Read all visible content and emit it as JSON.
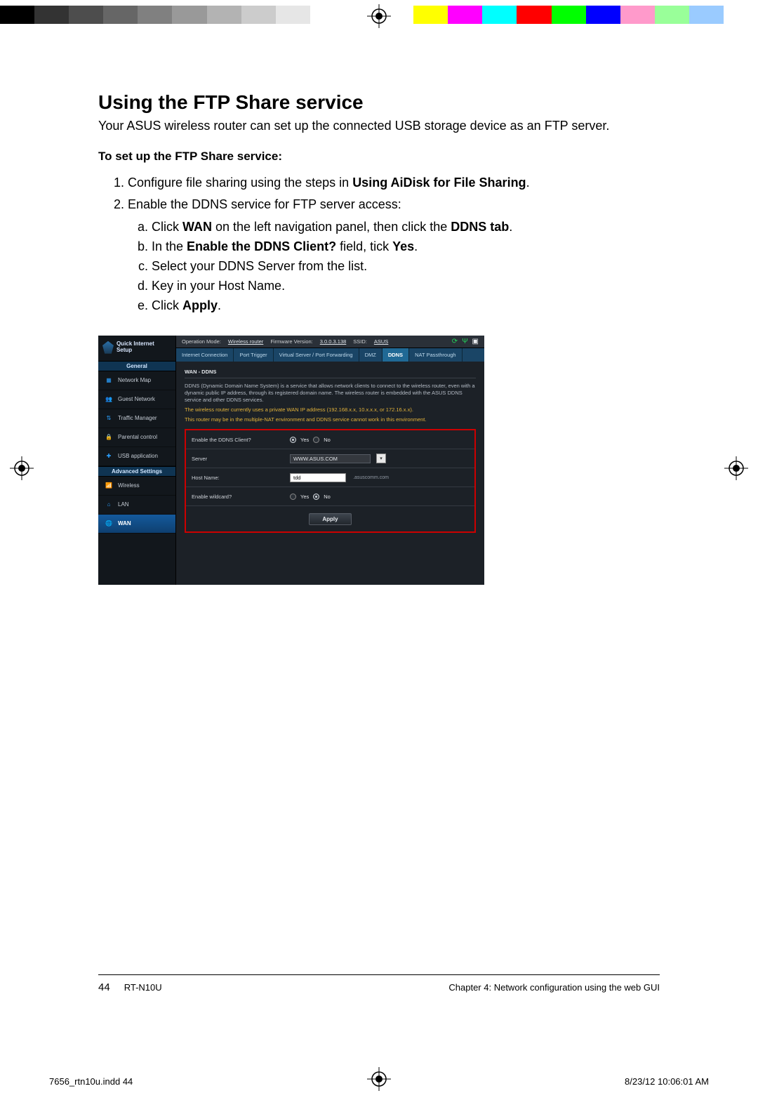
{
  "colorbar": [
    "#000000",
    "#333333",
    "#4d4d4d",
    "#666666",
    "#808080",
    "#999999",
    "#b3b3b3",
    "#cccccc",
    "#e6e6e6",
    "#ffffff",
    "spacer",
    "#ffff00",
    "#ff00ff",
    "#00ffff",
    "#ff0000",
    "#00ff00",
    "#0000ff",
    "#ff9acb",
    "#99ff99",
    "#9acbff",
    "#ffffff"
  ],
  "doc": {
    "title": "Using the FTP Share service",
    "intro": "Your ASUS wireless router can set up the connected USB storage device as an FTP server.",
    "subhead": "To set up the FTP Share service:",
    "steps": {
      "s1_pre": "Configure file sharing using the steps in ",
      "s1_bold": "Using AiDisk for File Sharing",
      "s1_post": ".",
      "s2": "Enable the DDNS service for FTP server access:",
      "sub": {
        "a_pre": "Click ",
        "a_b1": "WAN",
        "a_mid": " on the left navigation panel, then click the ",
        "a_b2": "DDNS tab",
        "a_post": ".",
        "b_pre": "In the ",
        "b_b1": "Enable the DDNS Client?",
        "b_mid": " field, tick ",
        "b_b2": "Yes",
        "b_post": ".",
        "c": "Select your DDNS Server from the list.",
        "d": "Key in your Host Name.",
        "e_pre": "Click ",
        "e_b1": "Apply",
        "e_post": "."
      }
    }
  },
  "shot": {
    "quick_setup": "Quick Internet Setup",
    "status": {
      "op_label": "Operation Mode:",
      "op_value": "Wireless router",
      "fw_label": "Firmware Version:",
      "fw_value": "3.0.0.3.138",
      "ssid_label": "SSID:",
      "ssid_value": "ASUS"
    },
    "side": {
      "general": "General",
      "network_map": "Network Map",
      "guest_network": "Guest Network",
      "traffic_manager": "Traffic Manager",
      "parental_control": "Parental control",
      "usb_application": "USB application",
      "advanced": "Advanced Settings",
      "wireless": "Wireless",
      "lan": "LAN",
      "wan": "WAN"
    },
    "tabs": {
      "internet": "Internet Connection",
      "port_trigger": "Port Trigger",
      "vs": "Virtual Server / Port Forwarding",
      "dmz": "DMZ",
      "ddns": "DDNS",
      "nat": "NAT Passthrough"
    },
    "panel": {
      "title": "WAN - DDNS",
      "desc": "DDNS (Dynamic Domain Name System) is a service that allows network clients to connect to the wireless router, even with a dynamic public IP address, through its registered domain name. The wireless router is embedded with the ASUS DDNS service and other DDNS services.",
      "warn1": "The wireless router currently uses a private WAN IP address (192.168.x.x, 10.x.x.x, or 172.16.x.x).",
      "warn2": "This router may be in the multiple-NAT environment and DDNS service cannot work in this environment."
    },
    "form": {
      "enable_label": "Enable the DDNS Client?",
      "yes": "Yes",
      "no": "No",
      "server_label": "Server",
      "server_value": "WWW.ASUS.COM",
      "host_label": "Host Name:",
      "host_value": "tdd",
      "host_suffix": ".asuscomm.com",
      "wildcard_label": "Enable wildcard?",
      "apply": "Apply"
    }
  },
  "footer": {
    "page": "44",
    "model": "RT-N10U",
    "chapter": "Chapter 4: Network configuration using the web GUI"
  },
  "slug": {
    "left": "7656_rtn10u.indd   44",
    "right": "8/23/12   10:06:01 AM"
  }
}
